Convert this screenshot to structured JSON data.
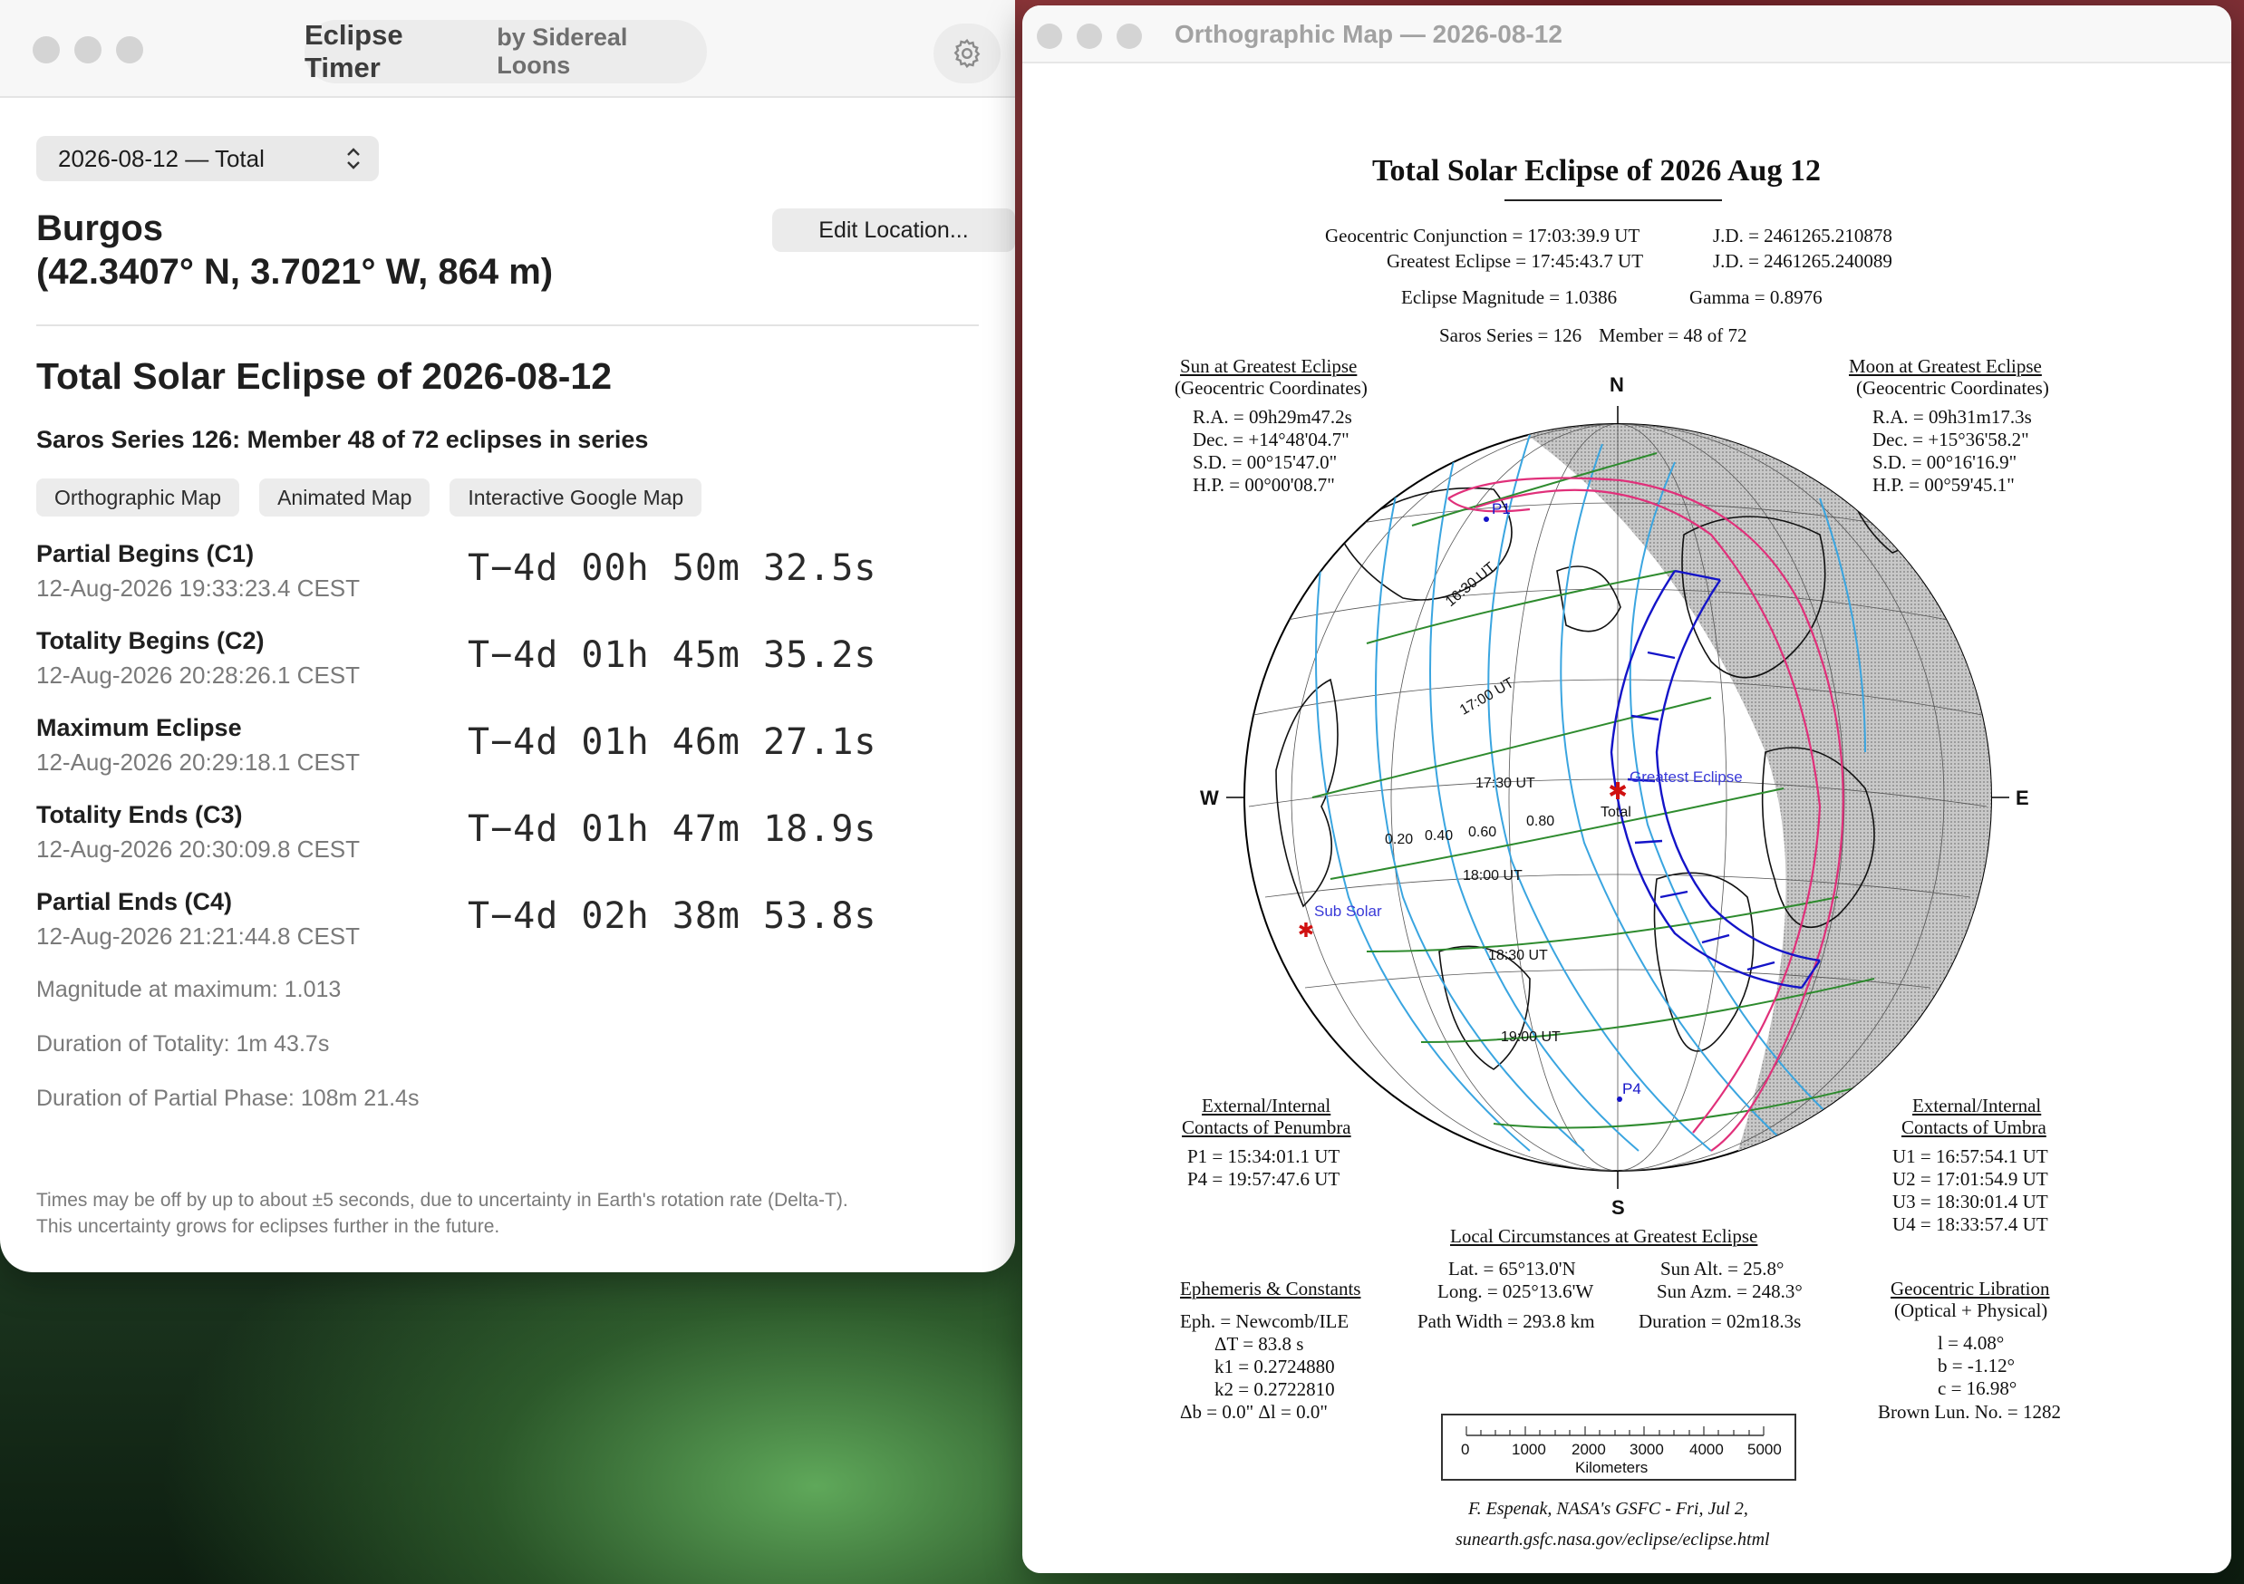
{
  "left_window": {
    "app_title": "Eclipse Timer",
    "app_by": "by Sidereal Loons",
    "eclipse_select": "2026-08-12 — Total",
    "location_name": "Burgos",
    "location_coords": "(42.3407° N, 3.7021° W, 864 m)",
    "edit_location_label": "Edit Location...",
    "eclipse_title": "Total Solar Eclipse of 2026-08-12",
    "saros": "Saros Series 126: Member 48 of 72 eclipses in series",
    "links": [
      "Orthographic Map",
      "Animated Map",
      "Interactive Google Map"
    ],
    "contacts": [
      {
        "name": "Partial Begins (C1)",
        "time": "12-Aug-2026 19:33:23.4 CEST",
        "countdown": "T−4d 00h 50m 32.5s"
      },
      {
        "name": "Totality Begins (C2)",
        "time": "12-Aug-2026 20:28:26.1 CEST",
        "countdown": "T−4d 01h 45m 35.2s"
      },
      {
        "name": "Maximum Eclipse",
        "time": "12-Aug-2026 20:29:18.1 CEST",
        "countdown": "T−4d 01h 46m 27.1s"
      },
      {
        "name": "Totality Ends (C3)",
        "time": "12-Aug-2026 20:30:09.8 CEST",
        "countdown": "T−4d 01h 47m 18.9s"
      },
      {
        "name": "Partial Ends (C4)",
        "time": "12-Aug-2026 21:21:44.8 CEST",
        "countdown": "T−4d 02h 38m 53.8s"
      }
    ],
    "magnitude": "Magnitude at maximum: 1.013",
    "duration_totality": "Duration of Totality: 1m 43.7s",
    "duration_partial": "Duration of Partial Phase: 108m 21.4s",
    "footnote_line1": "Times may be off by up to about ±5 seconds, due to uncertainty in Earth's rotation rate (Delta-T).",
    "footnote_line2": "This uncertainty grows for eclipses further in the future."
  },
  "right_window": {
    "window_title": "Orthographic Map — 2026-08-12",
    "map": {
      "title": "Total Solar Eclipse of  2026 Aug 12",
      "geo_conj": "Geocentric Conjunction =  17:03:39.9 UT",
      "greatest": "Greatest Eclipse =  17:45:43.7 UT",
      "jd1": "J.D. =  2461265.210878",
      "jd2": "J.D. =  2461265.240089",
      "magnitude": "Eclipse Magnitude =  1.0386",
      "gamma": "Gamma =  0.8976",
      "saros": "Saros Series = 126",
      "member": "Member = 48 of 72",
      "sun_head1": "Sun at Greatest Eclipse",
      "sun_head2": "(Geocentric Coordinates)",
      "sun_ra": "R.A. = 09h29m47.2s",
      "sun_dec": "Dec. = +14°48'04.7\"",
      "sun_sd": "S.D. =  00°15'47.0\"",
      "sun_hp": "H.P. =  00°00'08.7\"",
      "moon_head1": "Moon at Greatest Eclipse",
      "moon_head2": "(Geocentric Coordinates)",
      "moon_ra": "R.A. = 09h31m17.3s",
      "moon_dec": "Dec. = +15°36'58.2\"",
      "moon_sd": "S.D. =  00°16'16.9\"",
      "moon_hp": "H.P. =  00°59'45.1\"",
      "compass_n": "N",
      "compass_s": "S",
      "compass_w": "W",
      "compass_e": "E",
      "globe_labels": {
        "p1": "P1",
        "p4": "P4",
        "ut1630": "16:30 UT",
        "ut1700": "17:00 UT",
        "ut1730": "17:30 UT",
        "ut1800": "18:00 UT",
        "ut1830": "18:30 UT",
        "ut1900": "19:00 UT",
        "m020": "0.20",
        "m040": "0.40",
        "m060": "0.60",
        "m080": "0.80",
        "greatest_eclipse": "Greatest Eclipse",
        "total": "Total",
        "sub_solar": "Sub Solar"
      },
      "pen_head1": "External/Internal",
      "pen_head2": "Contacts of Penumbra",
      "pen_p1": "P1 = 15:34:01.1 UT",
      "pen_p4": "P4 = 19:57:47.6 UT",
      "umb_head1": "External/Internal",
      "umb_head2": "Contacts of Umbra",
      "umb_u1": "U1 = 16:57:54.1 UT",
      "umb_u2": "U2 = 17:01:54.9 UT",
      "umb_u3": "U3 = 18:30:01.4 UT",
      "umb_u4": "U4 = 18:33:57.4 UT",
      "local_head": "Local Circumstances at Greatest Eclipse",
      "local_lat": "Lat. =  65°13.0'N",
      "local_long": "Long. = 025°13.6'W",
      "local_sunalt": "Sun Alt. =   25.8°",
      "local_sunazm": "Sun Azm. = 248.3°",
      "local_path": "Path Width = 293.8 km",
      "local_duration": "Duration =  02m18.3s",
      "eph_head": "Ephemeris & Constants",
      "eph_1": "Eph. = Newcomb/ILE",
      "eph_2": "ΔT =     83.8 s",
      "eph_3": "k1 = 0.2724880",
      "eph_4": "k2 = 0.2722810",
      "eph_5": "Δb =   0.0\"     Δl =   0.0\"",
      "lib_head1": "Geocentric Libration",
      "lib_head2": "(Optical + Physical)",
      "lib_l": "l =    4.08°",
      "lib_b": "b =   -1.12°",
      "lib_c": "c =   16.98°",
      "lib_brown": "Brown Lun. No. = 1282",
      "scale_ticks": [
        "0",
        "1000",
        "2000",
        "3000",
        "4000",
        "5000"
      ],
      "scale_unit": "Kilometers",
      "credit1": "F. Espenak, NASA's GSFC - Fri, Jul 2,",
      "credit2": "sunearth.gsfc.nasa.gov/eclipse/eclipse.html"
    }
  },
  "colors": {
    "penumbra_contours": "#3aa5e0",
    "umbra_path": "#1414c8",
    "rise_set_curve": "#e0307a",
    "time_lines": "#2e8b2e",
    "night_shade": "#bdbdbd"
  }
}
